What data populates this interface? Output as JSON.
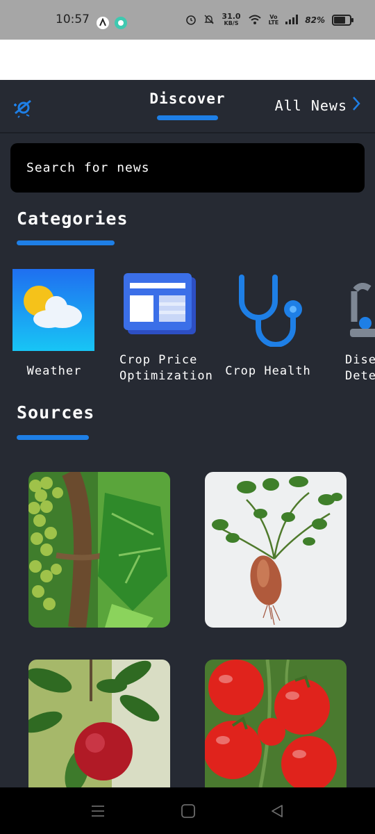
{
  "status_bar": {
    "time": "10:57",
    "net_speed_value": "31.0",
    "net_speed_unit": "KB/S",
    "volte_top": "Vo",
    "volte_bottom": "LTE",
    "battery": "82%",
    "battery_level": 0.82
  },
  "header": {
    "tab_discover": "Discover",
    "all_news": "All News"
  },
  "search": {
    "placeholder": "Search for news"
  },
  "categories": {
    "title": "Categories",
    "items": [
      {
        "label": "Weather",
        "icon": "weather-icon"
      },
      {
        "label_line1": "Crop Price",
        "label_line2": "Optimization",
        "icon": "news-layout-icon"
      },
      {
        "label": "Crop Health",
        "icon": "stethoscope-icon"
      },
      {
        "label_line1": "Disea",
        "label_line2": "Dete",
        "icon": "microscope-icon"
      }
    ]
  },
  "sources": {
    "title": "Sources",
    "items": [
      {
        "image": "grapes-vine-image"
      },
      {
        "image": "sweet-potato-plant-image"
      },
      {
        "image": "apple-tree-image"
      },
      {
        "image": "tomatoes-image"
      }
    ]
  },
  "colors": {
    "background": "#262a33",
    "accent": "#1e7fe6",
    "search_bg": "#000000"
  }
}
